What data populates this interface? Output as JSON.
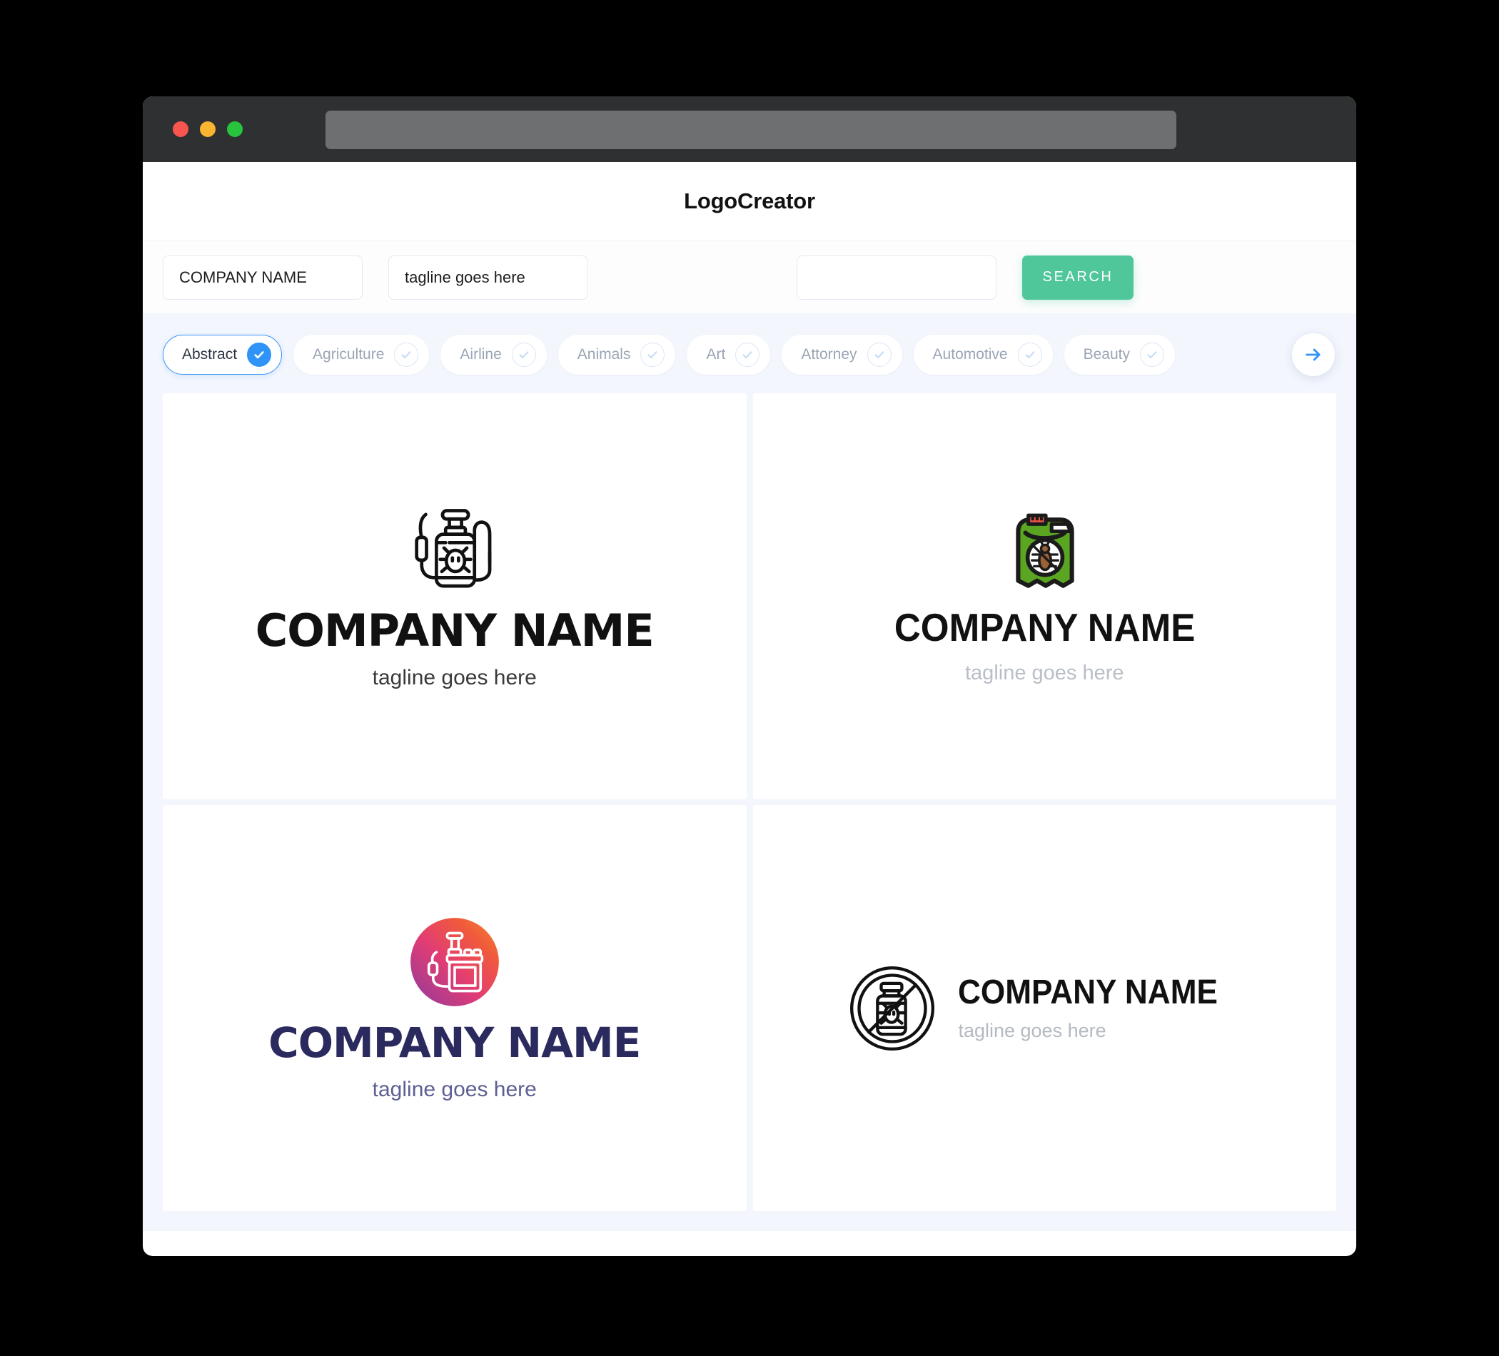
{
  "window": {
    "traffic_lights": [
      "close",
      "minimize",
      "maximize"
    ],
    "url_value": ""
  },
  "header": {
    "title": "LogoCreator"
  },
  "search": {
    "company_value": "COMPANY NAME",
    "company_placeholder": "COMPANY NAME",
    "tagline_value": "tagline goes here",
    "tagline_placeholder": "tagline goes here",
    "keyword_value": "",
    "keyword_placeholder": "",
    "search_label": "SEARCH"
  },
  "categories": {
    "next_icon": "arrow-right-icon",
    "items": [
      {
        "label": "Abstract",
        "selected": true
      },
      {
        "label": "Agriculture",
        "selected": false
      },
      {
        "label": "Airline",
        "selected": false
      },
      {
        "label": "Animals",
        "selected": false
      },
      {
        "label": "Art",
        "selected": false
      },
      {
        "label": "Attorney",
        "selected": false
      },
      {
        "label": "Automotive",
        "selected": false
      },
      {
        "label": "Beauty",
        "selected": false
      }
    ]
  },
  "results": {
    "cards": [
      {
        "icon": "pest-sprayer-outline-icon",
        "name": "COMPANY NAME",
        "tagline": "tagline goes here",
        "name_color": "#111111",
        "tagline_color": "#3a3a3a",
        "layout": "stacked"
      },
      {
        "icon": "green-jerrycan-bug-icon",
        "name": "COMPANY NAME",
        "tagline": "tagline goes here",
        "name_color": "#111111",
        "tagline_color": "#b9bec7",
        "layout": "stacked"
      },
      {
        "icon": "gradient-circle-sprayer-icon",
        "name": "COMPANY NAME",
        "tagline": "tagline goes here",
        "name_color": "#2b2a5e",
        "tagline_color": "#5d5f93",
        "layout": "stacked"
      },
      {
        "icon": "no-pesticide-prohibition-icon",
        "name": "COMPANY NAME",
        "tagline": "tagline goes here",
        "name_color": "#111111",
        "tagline_color": "#b4b9c2",
        "layout": "horizontal"
      }
    ]
  },
  "colors": {
    "accent_green": "#4fc79b",
    "accent_blue": "#2f93f7",
    "page_bg": "#f3f6fd",
    "titlebar": "#2f3031",
    "jerrycan_green": "#5aa522",
    "jerrycan_cap_red": "#f4554a",
    "bug_brown": "#9c6035",
    "gradient_start": "#8e3a9e",
    "gradient_end": "#f4722b",
    "navy": "#2b2a5e"
  }
}
